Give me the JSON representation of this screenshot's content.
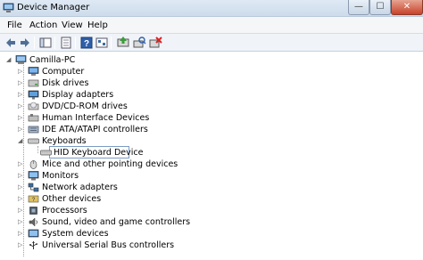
{
  "window": {
    "title": "Device Manager",
    "controls": {
      "minimize": "—",
      "maximize": "☐",
      "close": "✕"
    }
  },
  "menu": [
    "File",
    "Action",
    "View",
    "Help"
  ],
  "toolbar": [
    "back-icon",
    "forward-icon",
    "show-hide-console-tree-icon",
    "properties-icon",
    "help-icon",
    "update-driver-icon",
    "scan-hardware-icon",
    "uninstall-icon"
  ],
  "tree": {
    "root": "Camilla-PC",
    "categories": [
      {
        "label": "Computer",
        "icon": "computer-icon",
        "expanded": false
      },
      {
        "label": "Disk drives",
        "icon": "disk-drive-icon",
        "expanded": false
      },
      {
        "label": "Display adapters",
        "icon": "display-adapter-icon",
        "expanded": false
      },
      {
        "label": "DVD/CD-ROM drives",
        "icon": "dvd-drive-icon",
        "expanded": false
      },
      {
        "label": "Human Interface Devices",
        "icon": "hid-icon",
        "expanded": false
      },
      {
        "label": "IDE ATA/ATAPI controllers",
        "icon": "ide-controller-icon",
        "expanded": false
      },
      {
        "label": "Keyboards",
        "icon": "keyboard-icon",
        "expanded": true
      },
      {
        "label": "HID Keyboard Device",
        "icon": "keyboard-icon",
        "child": true,
        "selected": true
      },
      {
        "label": "Mice and other pointing devices",
        "icon": "mouse-icon",
        "expanded": false
      },
      {
        "label": "Monitors",
        "icon": "monitor-icon",
        "expanded": false
      },
      {
        "label": "Network adapters",
        "icon": "network-adapter-icon",
        "expanded": false
      },
      {
        "label": "Other devices",
        "icon": "other-devices-icon",
        "expanded": false
      },
      {
        "label": "Processors",
        "icon": "processor-icon",
        "expanded": false
      },
      {
        "label": "Sound, video and game controllers",
        "icon": "sound-icon",
        "expanded": false
      },
      {
        "label": "System devices",
        "icon": "system-devices-icon",
        "expanded": false
      },
      {
        "label": "Universal Serial Bus controllers",
        "icon": "usb-icon",
        "expanded": false
      }
    ]
  }
}
